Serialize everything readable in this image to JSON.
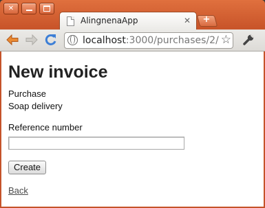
{
  "window": {
    "close_glyph": "✕",
    "min_glyph": "",
    "max_glyph": ""
  },
  "tab": {
    "title": "AlingnenaApp",
    "close_glyph": "✕",
    "newtab_glyph": "+"
  },
  "toolbar": {
    "back_glyph": "⬅",
    "forward_glyph": "➡",
    "reload_glyph": "↻",
    "star_glyph": "☆"
  },
  "address": {
    "host": "localhost",
    "path": ":3000/purchases/2/"
  },
  "page": {
    "heading": "New invoice",
    "purchase_label": "Purchase",
    "purchase_value": "Soap delivery",
    "reference_label": "Reference number",
    "reference_value": "",
    "create_button": "Create",
    "back_link": "Back"
  },
  "colors": {
    "titlebar": "#c9552a",
    "back_arrow": "#e07c2c",
    "reload": "#3d7fd6"
  }
}
